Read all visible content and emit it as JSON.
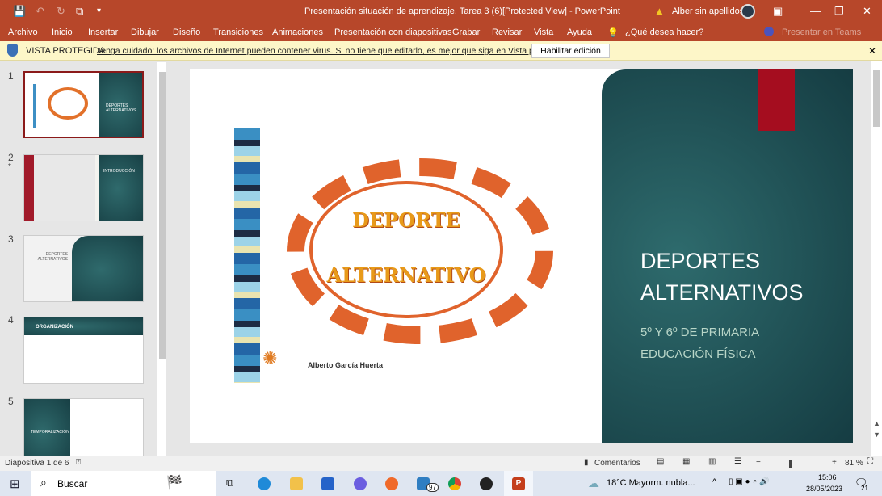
{
  "window": {
    "title": "Presentación situación de aprendizaje. Tarea 3 (6)[Protected View] - PowerPoint",
    "user": "Alber sin apellidos"
  },
  "menu": [
    "Archivo",
    "Inicio",
    "Insertar",
    "Dibujar",
    "Diseño",
    "Transiciones",
    "Animaciones",
    "Presentación con diapositivas",
    "Grabar",
    "Revisar",
    "Vista",
    "Ayuda"
  ],
  "tell_me": "¿Qué desea hacer?",
  "present_teams": "Presentar en Teams",
  "protected": {
    "label": "VISTA PROTEGIDA",
    "message": "Tenga cuidado: los archivos de Internet pueden contener virus. Si no tiene que editarlo, es mejor que siga en Vista protegida.",
    "button": "Habilitar edición"
  },
  "thumbnails": [
    {
      "num": "1",
      "title": "DEPORTES ALTERNATIVOS"
    },
    {
      "num": "2",
      "title": "INTRODUCCIÓN"
    },
    {
      "num": "3",
      "title": "DEPORTES ALTERNATIVOS"
    },
    {
      "num": "4",
      "title": "ORGANIZACIÓN"
    },
    {
      "num": "5",
      "title": "TEMPORALIZACIÓN"
    }
  ],
  "slide": {
    "logo_line1": "DEPORTE",
    "logo_line2": "ALTERNATIVO",
    "author": "Alberto García Huerta",
    "title_line1": "DEPORTES",
    "title_line2": "ALTERNATIVOS",
    "subtitle1": "5º Y 6º DE PRIMARIA",
    "subtitle2": "EDUCACIÓN FÍSICA"
  },
  "status": {
    "slide_info": "Diapositiva 1 de 6",
    "comments": "Comentarios",
    "zoom": "81 %",
    "zoom_level": 81
  },
  "taskbar": {
    "search": "Buscar",
    "weather": "18°C  Mayorm. nubla...",
    "time": "15:06",
    "date": "28/05/2023",
    "mail_badge": "97",
    "notif_badge": "21"
  },
  "colors": {
    "accent": "#b7472a",
    "teal": "#1f4f53",
    "red_tab": "#a50d1f"
  }
}
